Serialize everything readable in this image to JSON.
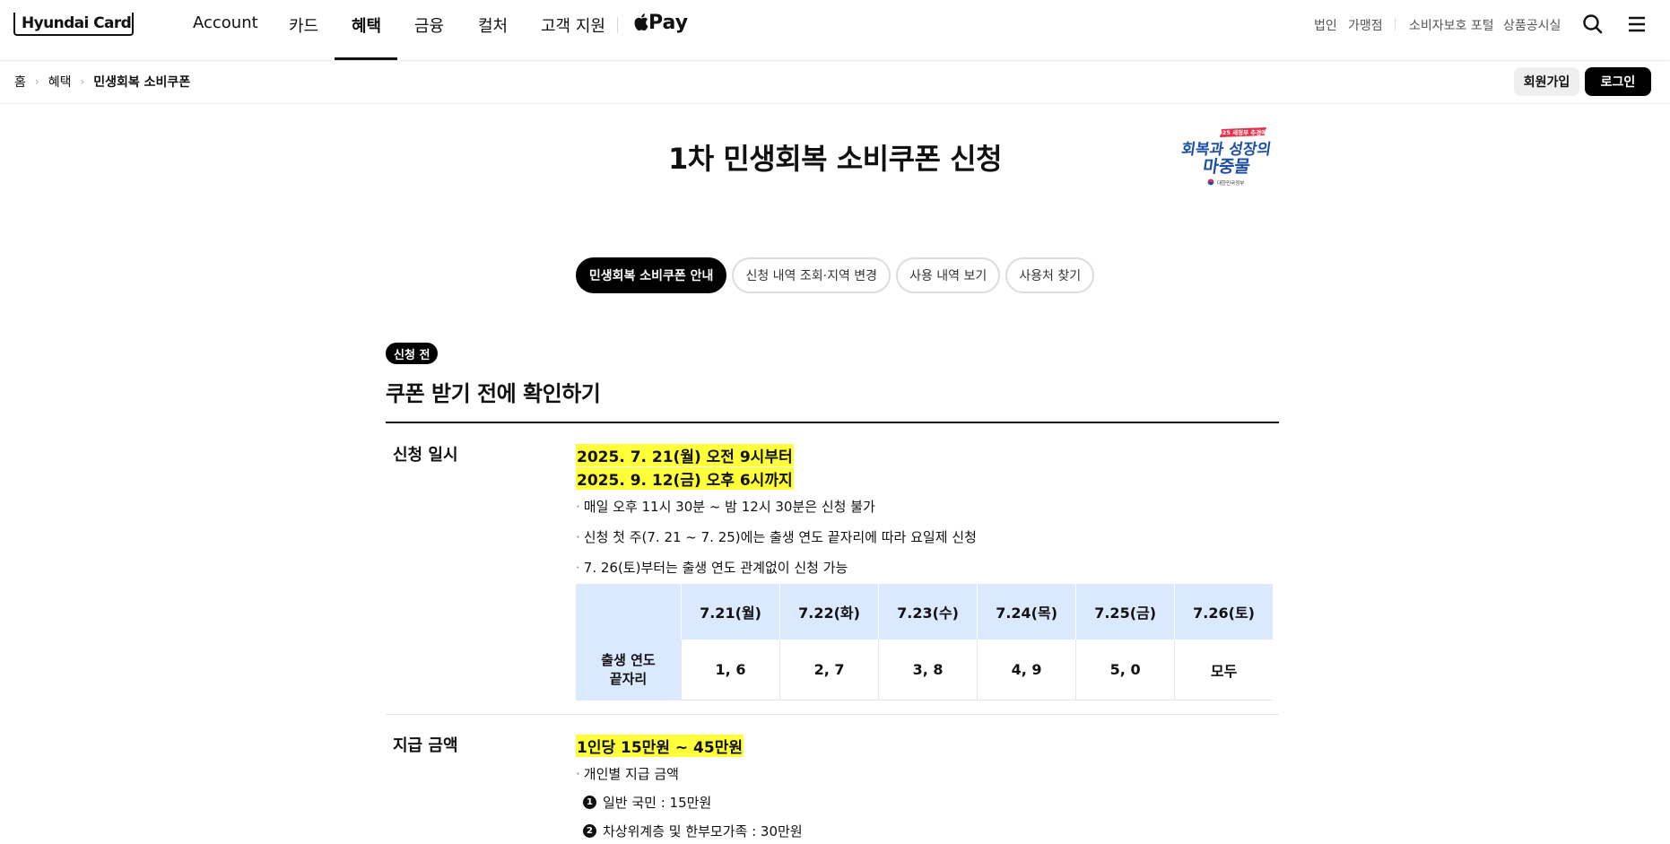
{
  "header": {
    "logo_text": "Hyundai Card",
    "nav": [
      "Account",
      "카드",
      "혜택",
      "금융",
      "컬처",
      "고객 지원"
    ],
    "active_nav": "혜택",
    "apple_pay": "Pay",
    "utility_links": [
      "법인",
      "가맹점",
      "소비자보호 포털",
      "상품공시실"
    ]
  },
  "breadcrumb": [
    "홈",
    "혜택",
    "민생회복 소비쿠폰"
  ],
  "auth": {
    "join_label": "회원가입",
    "login_label": "로그인"
  },
  "page_title": "1차 민생회복 소비쿠폰 신청",
  "emblem": {
    "top_text": "2025 새정부 추경예산",
    "line1": "회복과 성장의",
    "line2": "마중물",
    "org": "대한민국정부"
  },
  "tabs": [
    "민생회복 소비쿠폰 안내",
    "신청 내역 조회·지역 변경",
    "사용 내역 보기",
    "사용처 찾기"
  ],
  "active_tab": 0,
  "section": {
    "badge": "신청 전",
    "title": "쿠폰 받기 전에 확인하기",
    "period": {
      "label": "신청 일시",
      "highlights": [
        "2025. 7. 21(월) 오전 9시부터",
        "2025. 9. 12(금) 오후 6시까지"
      ],
      "bullets": [
        "매일 오후 11시 30분 ~ 밤 12시 30분은 신청 불가",
        "신청 첫 주(7. 21 ~ 7. 25)에는 출생 연도 끝자리에 따라 요일제 신청",
        "7. 26(토)부터는 출생 연도 관계없이 신청 가능"
      ],
      "table": {
        "days": [
          "7.21(월)",
          "7.22(화)",
          "7.23(수)",
          "7.24(목)",
          "7.25(금)",
          "7.26(토)"
        ],
        "row_header_line1": "출생 연도",
        "row_header_line2": "끝자리",
        "values": [
          "1, 6",
          "2, 7",
          "3, 8",
          "4, 9",
          "5, 0",
          "모두"
        ]
      }
    },
    "amount": {
      "label": "지급 금액",
      "highlight": "1인당 15만원 ~ 45만원",
      "bullet": "개인별 지급 금액",
      "items": [
        {
          "n": "1",
          "text": "일반 국민 : 15만원"
        },
        {
          "n": "2",
          "text": "차상위계층 및 한부모가족 : 30만원"
        }
      ]
    }
  }
}
